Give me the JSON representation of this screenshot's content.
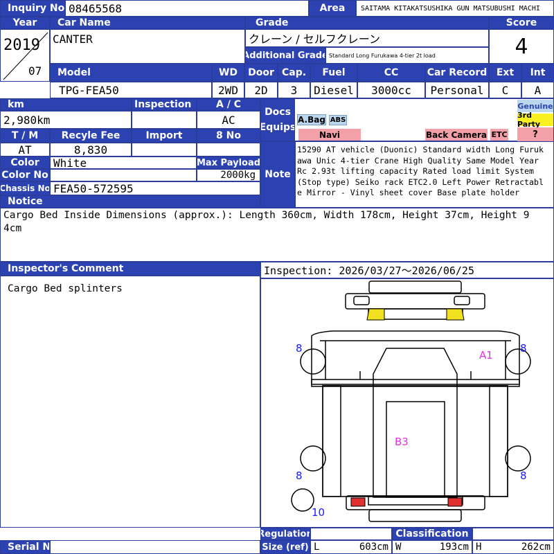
{
  "header": {
    "inquiry_label": "Inquiry No",
    "inquiry_value": "08465568",
    "area_label": "Area",
    "area_value": "SAITAMA KITAKATSUSHIKA GUN MATSUBUSHI MACHI",
    "year_label": "Year",
    "year_value": "2019",
    "month_value": "07",
    "car_name_label": "Car Name",
    "car_name_value": "CANTER",
    "grade_label": "Grade",
    "grade_value": "クレーン / セルフクレーン",
    "additional_grade_label": "Additional Grade",
    "additional_grade_value": "Standard Long Furukawa 4-tier 2t load",
    "score_label": "Score",
    "score_value": "4"
  },
  "specs": {
    "model_label": "Model",
    "model_value": "TPG-FEA50",
    "wd_label": "WD",
    "wd_value": "2WD",
    "door_label": "Door",
    "door_value": "2D",
    "cap_label": "Cap.",
    "cap_value": "3",
    "fuel_label": "Fuel",
    "fuel_value": "Diesel",
    "cc_label": "CC",
    "cc_value": "3000cc",
    "record_label": "Car Record",
    "record_value": "Personal",
    "ext_label": "Ext",
    "ext_value": "C",
    "int_label": "Int",
    "int_value": "A"
  },
  "details": {
    "km_label": "km",
    "km_value": "2,980km",
    "inspection_label": "Inspection",
    "inspection_value": "",
    "ac_label": "A / C",
    "ac_value": "AC",
    "tm_label": "T / M",
    "tm_value": "AT",
    "recycle_label": "Recyle Fee",
    "recycle_value": "8,830",
    "import_label": "Import",
    "import_value": "",
    "eight_no_label": "8 No",
    "eight_no_value": "",
    "color_label": "Color",
    "color_value": "White",
    "max_payload_label": "Max Payload",
    "max_payload_value": "2000kg",
    "color_no_label": "Color No",
    "color_no_value": "",
    "chassis_label": "Chassis No",
    "chassis_value": "FEA50-572595"
  },
  "docs": {
    "docs_label": "Docs",
    "equips_label": "Equips",
    "abag": "A.Bag",
    "abs": "ABS",
    "navi": "Navi",
    "back_camera": "Back Camera",
    "etc": "ETC",
    "genuine": "Genuine",
    "third_party": "3rd Party",
    "unknown": "?"
  },
  "note": {
    "label": "Note",
    "text": "15290 AT vehicle (Duonic) Standard width Long Furukawa Unic 4-tier Crane High Quality Same Model Year Rc 2.93t lifting capacity Rated load limit System (Stop type) Seiko rack ETC2.0 Left Power Retractable Mirror - Vinyl sheet cover Base plate holder"
  },
  "notice": {
    "label": "Notice",
    "text": "Cargo Bed Inside Dimensions (approx.): Length 360cm, Width 178cm, Height 37cm, Height 94cm"
  },
  "inspector": {
    "label": "Inspector's Comment",
    "comment": "Cargo Bed splinters",
    "period": "Inspection: 2026/03/27～2026/06/25"
  },
  "diagram": {
    "marks": {
      "tire_fl": "8",
      "tire_fr": "8",
      "tire_rl": "8",
      "tire_rr": "8",
      "spare": "10",
      "a1": "A1",
      "b3": "B3"
    },
    "colors": {
      "mark_blue": "#1a1aff",
      "mark_magenta": "#e62ee6",
      "headlight": "#f0e020",
      "taillight": "#e03030"
    }
  },
  "footer": {
    "serial_label": "Serial No",
    "serial_value": "",
    "regulation_label": "Regulation",
    "size_label": "Size (ref)",
    "classification_label": "Classification",
    "classification_value": "",
    "l_label": "L",
    "l_value": "603cm",
    "w_label": "W",
    "w_value": "193cm",
    "h_label": "H",
    "h_value": "262cm"
  },
  "colors": {
    "header_blue": "#2b42b0",
    "badge_blue": "#bcd6ee",
    "badge_red": "#f4a0a8",
    "badge_yellow": "#f8f020"
  }
}
